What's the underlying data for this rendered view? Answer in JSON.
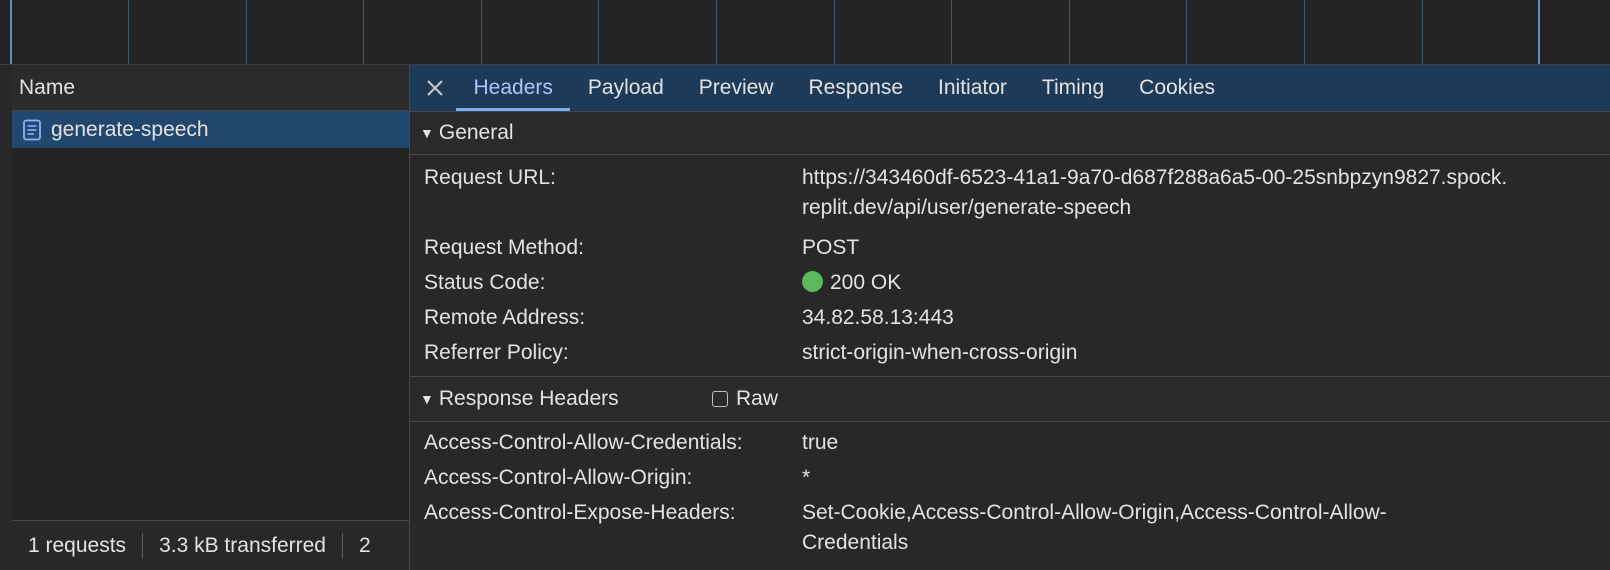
{
  "name_pane": {
    "column_header": "Name",
    "requests": [
      {
        "name": "generate-speech",
        "icon": "document-icon"
      }
    ],
    "status": {
      "requests": "1 requests",
      "transferred": "3.3 kB transferred",
      "resources": "2"
    }
  },
  "tabs": {
    "close_icon": "close-icon",
    "items": [
      "Headers",
      "Payload",
      "Preview",
      "Response",
      "Initiator",
      "Timing",
      "Cookies"
    ],
    "active": "Headers"
  },
  "general": {
    "title": "General",
    "rows": [
      {
        "key": "Request URL:",
        "value": "https://343460df-6523-41a1-9a70-d687f288a6a5-00-25snbpzyn9827.spock.",
        "value_line2": "replit.dev/api/user/generate-speech"
      },
      {
        "key": "Request Method:",
        "value": "POST"
      },
      {
        "key": "Status Code:",
        "value": "200 OK",
        "status_color": "#5cb85c"
      },
      {
        "key": "Remote Address:",
        "value": "34.82.58.13:443"
      },
      {
        "key": "Referrer Policy:",
        "value": "strict-origin-when-cross-origin"
      }
    ]
  },
  "response_headers": {
    "title": "Response Headers",
    "raw_label": "Raw",
    "raw_checked": false,
    "rows": [
      {
        "key": "Access-Control-Allow-Credentials:",
        "value": "true"
      },
      {
        "key": "Access-Control-Allow-Origin:",
        "value": "*"
      },
      {
        "key": "Access-Control-Expose-Headers:",
        "value": "Set-Cookie,Access-Control-Allow-Origin,Access-Control-Allow-",
        "value_line2": "Credentials"
      }
    ]
  },
  "colors": {
    "accent": "#7cacf8",
    "selected_row": "#21476e",
    "tab_bar": "#1d3a59",
    "ok_green": "#5cb85c"
  }
}
